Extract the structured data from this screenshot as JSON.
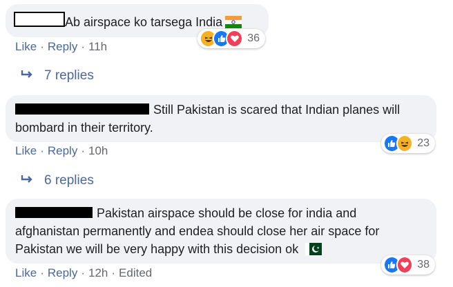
{
  "comments": [
    {
      "text": "Ab airspace ko tarsega India",
      "flag": "india-flag",
      "reactions": [
        "haha",
        "like",
        "love"
      ],
      "reaction_count": "36",
      "actions": {
        "like": "Like",
        "reply": "Reply",
        "time": "11h"
      },
      "replies_label": "7 replies"
    },
    {
      "text_line1": "Still Pakistan is scared that Indian planes will",
      "text_line2": "bombard in their territory.",
      "reactions": [
        "like",
        "haha"
      ],
      "reaction_count": "23",
      "actions": {
        "like": "Like",
        "reply": "Reply",
        "time": "10h"
      },
      "replies_label": "6 replies"
    },
    {
      "text_line1": "Pakistan airspace should be close for india and",
      "text_line2": "afghanistan permanently and endea should close her air space for",
      "text_line3": "Pakistan we will be very happy with this decision ok",
      "flag": "pakistan-flag",
      "reactions": [
        "like",
        "love"
      ],
      "reaction_count": "38",
      "actions": {
        "like": "Like",
        "reply": "Reply",
        "time": "12h",
        "edited": "Edited"
      }
    }
  ],
  "colors": {
    "bubble": "#f0f2f5",
    "link": "#4b67a1",
    "meta": "#65676b",
    "like": "#1877f2",
    "haha": "#f7b125",
    "love": "#f33e58"
  }
}
